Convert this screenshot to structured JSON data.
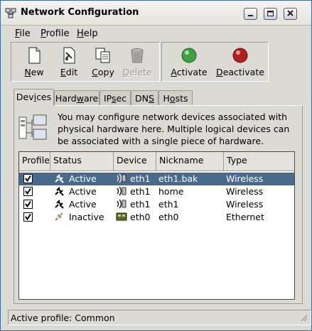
{
  "window": {
    "title": "Network Configuration"
  },
  "menu": [
    {
      "accel": "F",
      "rest": "ile"
    },
    {
      "accel": "P",
      "rest": "rofile"
    },
    {
      "accel": "H",
      "rest": "elp"
    }
  ],
  "toolbar": {
    "new": {
      "accel": "N",
      "rest": "ew"
    },
    "edit": {
      "accel": "E",
      "rest": "dit"
    },
    "copy": {
      "accel": "C",
      "rest": "opy"
    },
    "delete": {
      "accel": "D",
      "rest": "elete"
    },
    "activate": {
      "accel": "A",
      "rest": "ctivate"
    },
    "deactivate": {
      "accel": "D",
      "rest": "eactivate"
    }
  },
  "tabs": [
    {
      "pre": "Dev",
      "accel": "i",
      "post": "ces"
    },
    {
      "pre": "Hard",
      "accel": "w",
      "post": "are"
    },
    {
      "pre": "IP",
      "accel": "s",
      "post": "ec"
    },
    {
      "pre": "DN",
      "accel": "S",
      "post": ""
    },
    {
      "pre": "H",
      "accel": "o",
      "post": "sts"
    }
  ],
  "info_text": "You may configure network devices associated with physical hardware here.  Multiple logical devices can be associated with a single piece of hardware.",
  "table": {
    "headers": [
      "Profile",
      "Status",
      "Device",
      "Nickname",
      "Type"
    ],
    "rows": [
      {
        "status": "Active",
        "device": "eth1",
        "nickname": "eth1.bak",
        "type": "Wireless",
        "selected": true,
        "kind": "wireless"
      },
      {
        "status": "Active",
        "device": "eth1",
        "nickname": "home",
        "type": "Wireless",
        "selected": false,
        "kind": "wireless"
      },
      {
        "status": "Active",
        "device": "eth1",
        "nickname": "eth1",
        "type": "Wireless",
        "selected": false,
        "kind": "wireless"
      },
      {
        "status": "Inactive",
        "device": "eth0",
        "nickname": "eth0",
        "type": "Ethernet",
        "selected": false,
        "kind": "ethernet"
      }
    ]
  },
  "statusbar": "Active profile: Common"
}
